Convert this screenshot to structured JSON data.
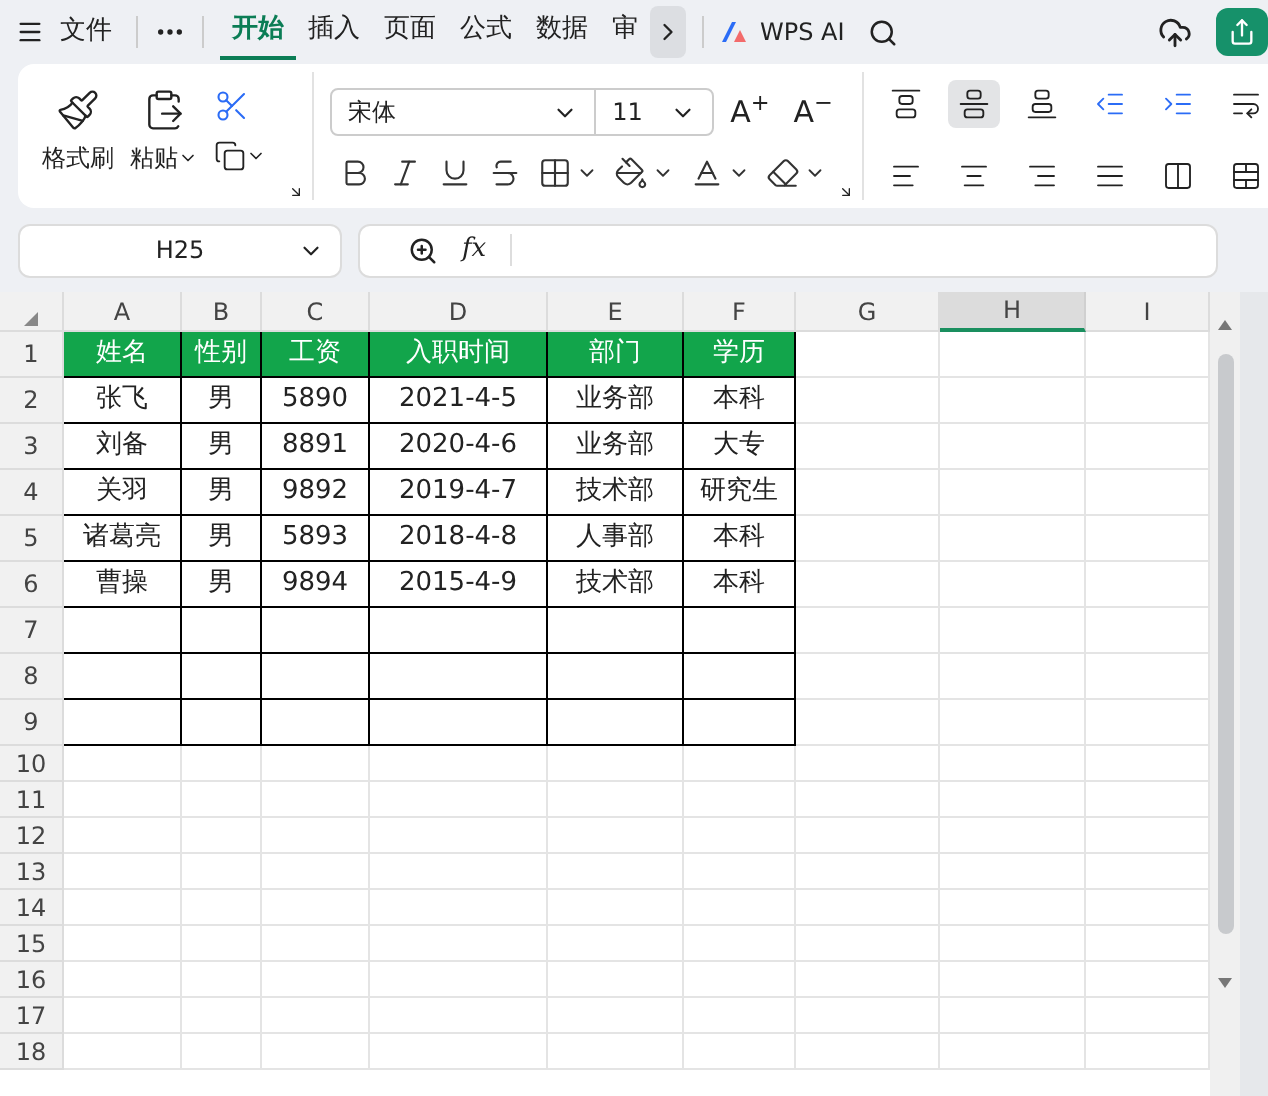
{
  "top_bar": {
    "file_menu": "文件",
    "tabs": [
      {
        "label": "开始",
        "selected": true
      },
      {
        "label": "插入",
        "selected": false
      },
      {
        "label": "页面",
        "selected": false
      },
      {
        "label": "公式",
        "selected": false
      },
      {
        "label": "数据",
        "selected": false
      },
      {
        "label": "审",
        "selected": false
      }
    ],
    "ai_button": "WPS AI"
  },
  "ribbon": {
    "format_painter": "格式刷",
    "paste": "粘贴",
    "font_family": "宋体",
    "font_size": "11",
    "size_buttons": [
      "A$^{+}$",
      "A$^{−}$"
    ],
    "alignment_buttons": [
      {
        "selected": false
      },
      {
        "selected": true
      },
      {
        "selected": false
      },
      {
        "selected": false
      },
      {
        "selected": false
      },
      {
        "selected": false
      },
      {
        "selected": false
      },
      {
        "selected": false
      },
      {
        "selected": false
      },
      {
        "selected": false
      },
      {
        "selected": false
      },
      {
        "selected": false
      }
    ]
  },
  "formula_bar": {
    "name_box": "H25",
    "function_label": "fx"
  },
  "sheet": {
    "columns": [
      {
        "label": "A",
        "selected": false
      },
      {
        "label": "B",
        "selected": false
      },
      {
        "label": "C",
        "selected": false
      },
      {
        "label": "D",
        "selected": false
      },
      {
        "label": "E",
        "selected": false
      },
      {
        "label": "F",
        "selected": false
      },
      {
        "label": "G",
        "selected": false
      },
      {
        "label": "H",
        "selected": true
      },
      {
        "label": "I",
        "selected": false
      }
    ],
    "row_numbers": [
      "1",
      "2",
      "3",
      "4",
      "5",
      "6",
      "7",
      "8",
      "9",
      "10",
      "11",
      "12",
      "13",
      "14",
      "15",
      "16",
      "17",
      "18"
    ],
    "table_rows": [
      {
        "kind": "header",
        "cells": [
          "姓名",
          "性别",
          "工资",
          "入职时间",
          "部门",
          "学历"
        ]
      },
      {
        "kind": "data",
        "cells": [
          "张飞",
          "男",
          "5890",
          "2021-4-5",
          "业务部",
          "本科"
        ]
      },
      {
        "kind": "data",
        "cells": [
          "刘备",
          "男",
          "8891",
          "2020-4-6",
          "业务部",
          "大专"
        ]
      },
      {
        "kind": "data",
        "cells": [
          "关羽",
          "男",
          "9892",
          "2019-4-7",
          "技术部",
          "研究生"
        ]
      },
      {
        "kind": "data",
        "cells": [
          "诸葛亮",
          "男",
          "5893",
          "2018-4-8",
          "人事部",
          "本科"
        ]
      },
      {
        "kind": "data",
        "cells": [
          "曹操",
          "男",
          "9894",
          "2015-4-9",
          "技术部",
          "本科"
        ]
      },
      {
        "kind": "data",
        "cells": [
          "",
          "",
          "",
          "",
          "",
          ""
        ]
      },
      {
        "kind": "data",
        "cells": [
          "",
          "",
          "",
          "",
          "",
          ""
        ]
      },
      {
        "kind": "data",
        "cells": [
          "",
          "",
          "",
          "",
          "",
          ""
        ]
      }
    ]
  }
}
